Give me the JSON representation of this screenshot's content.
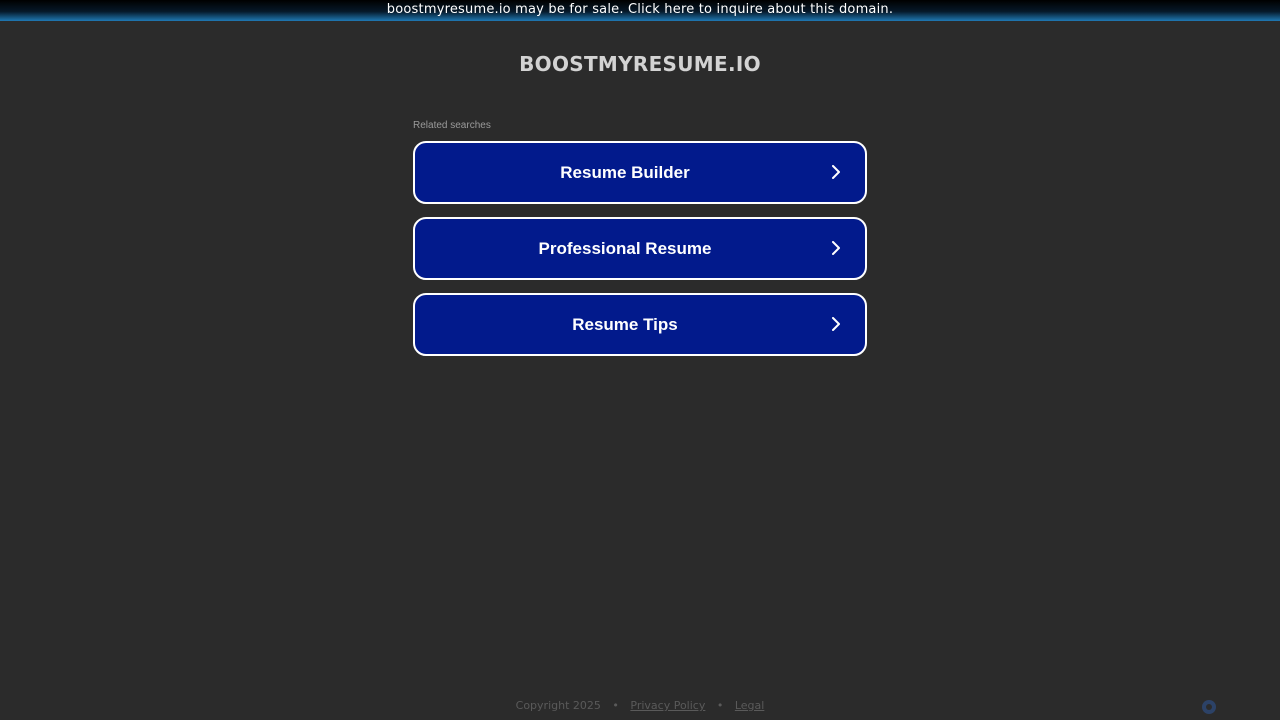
{
  "banner": {
    "text": "boostmyresume.io may be for sale. Click here to inquire about this domain."
  },
  "site": {
    "title": "BOOSTMYRESUME.IO"
  },
  "related": {
    "label": "Related searches",
    "items": [
      {
        "label": "Resume Builder",
        "icon": "chevron-right-icon"
      },
      {
        "label": "Professional Resume",
        "icon": "chevron-right-icon"
      },
      {
        "label": "Resume Tips",
        "icon": "chevron-right-icon"
      }
    ]
  },
  "footer": {
    "copyright": "Copyright 2025",
    "separator": "•",
    "privacy": "Privacy Policy",
    "legal": "Legal"
  },
  "corner_logo": {
    "icon": "brand-logo-icon"
  },
  "colors": {
    "background": "#2b2b2b",
    "button_fill": "#021a8c",
    "button_border": "#ffffff",
    "title_text": "#d3d3d3"
  }
}
